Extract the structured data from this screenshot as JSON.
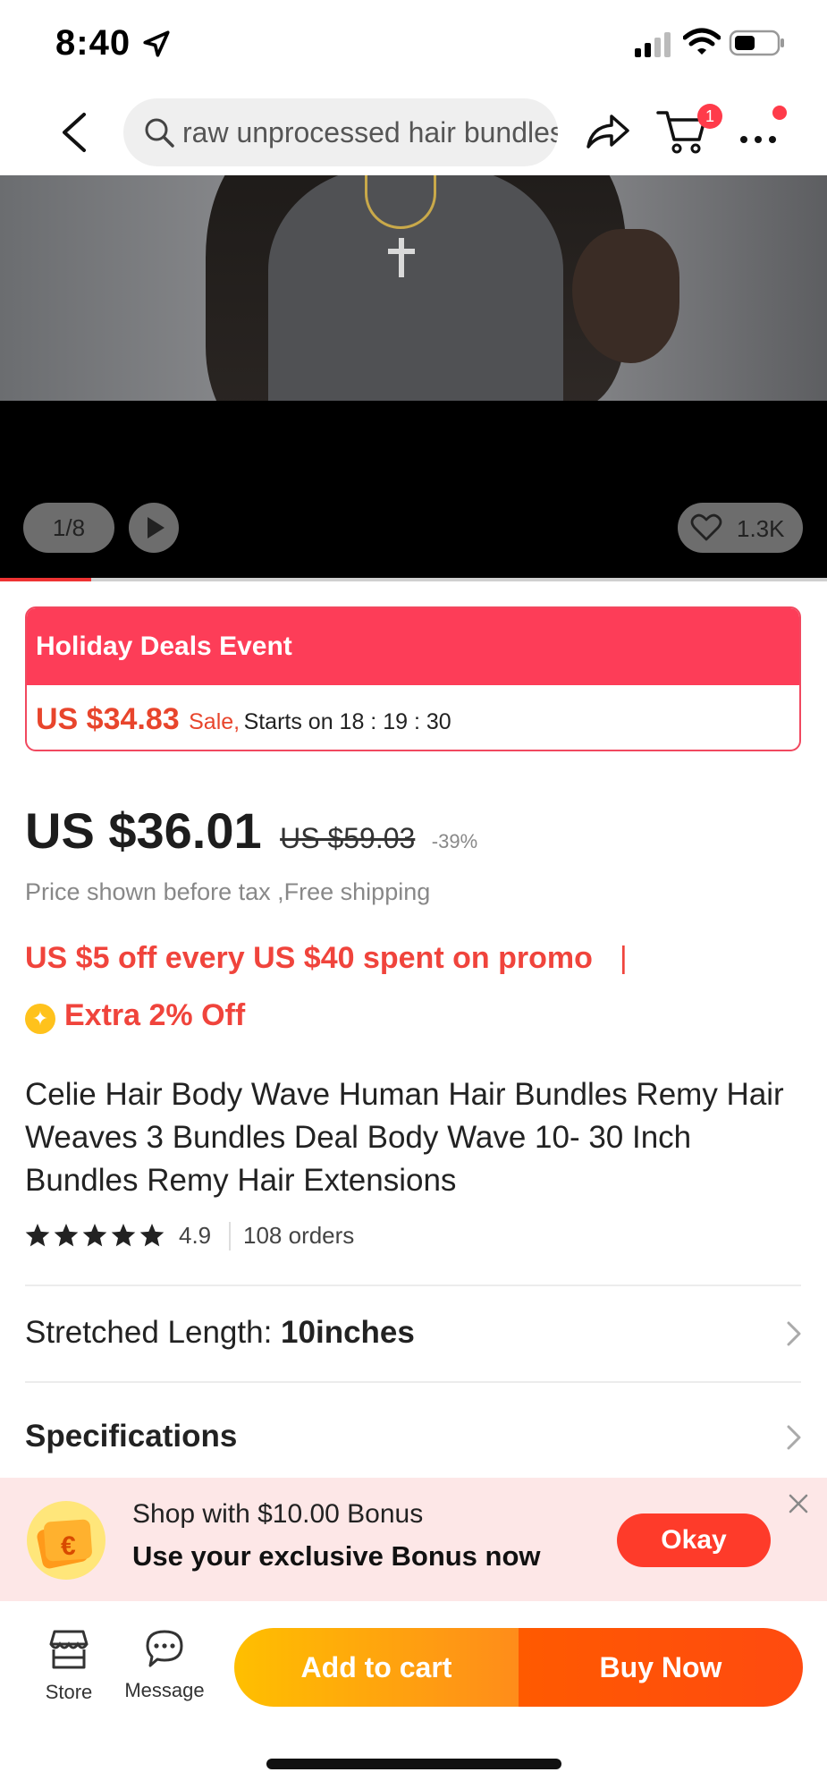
{
  "status_bar": {
    "time": "8:40"
  },
  "nav": {
    "search_text": "raw unprocessed hair bundles",
    "cart_badge": "1"
  },
  "media": {
    "pager": "1/8",
    "likes": "1.3K",
    "progress": 0.11
  },
  "deal": {
    "event_title": "Holiday Deals Event",
    "deal_price": "US $34.83",
    "sale_label": "Sale,",
    "starts": "Starts on 18 : 19 : 30"
  },
  "price": {
    "current": "US $36.01",
    "original": "US $59.03",
    "discount": "-39%",
    "tax_note": "Price shown before tax ,Free shipping"
  },
  "promo": {
    "text": "US $5 off every US $40 spent on promo",
    "separator": "|",
    "extra": "Extra 2% Off"
  },
  "product": {
    "title": "Celie Hair Body Wave Human Hair Bundles Remy Hair Weaves 3 Bundles Deal Body Wave 10- 30 Inch Bundles Remy Hair Extensions",
    "rating": "4.9",
    "stars": 5,
    "orders": "108 orders"
  },
  "options": {
    "length_label": "Stretched Length:",
    "length_value": "10inches",
    "specs_label": "Specifications"
  },
  "bonus": {
    "line1": "Shop with $10.00 Bonus",
    "line2": "Use your exclusive Bonus now",
    "okay": "Okay"
  },
  "bottom": {
    "store": "Store",
    "message": "Message",
    "add_to_cart": "Add to cart",
    "buy_now": "Buy Now"
  },
  "colors": {
    "accent_red": "#fd3d58",
    "price_red": "#e8452c",
    "cta_orange": "#ff8c1a"
  }
}
